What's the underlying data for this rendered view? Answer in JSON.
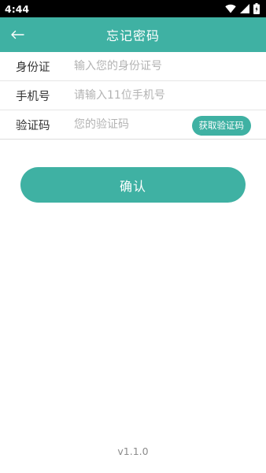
{
  "status_bar": {
    "time": "4:44",
    "icons": [
      "wifi-icon",
      "cell-signal-icon",
      "battery-charging-icon"
    ]
  },
  "app_bar": {
    "title": "忘记密码",
    "back_icon": "arrow-left-icon"
  },
  "form": {
    "id_card": {
      "label": "身份证",
      "placeholder": "输入您的身份证号",
      "value": ""
    },
    "phone": {
      "label": "手机号",
      "placeholder": "请输入11位手机号",
      "value": ""
    },
    "code": {
      "label": "验证码",
      "placeholder": "您的验证码",
      "value": "",
      "button_label": "获取验证码"
    }
  },
  "confirm_label": "确认",
  "version": "v1.1.0",
  "colors": {
    "accent": "#3fb1a3",
    "status_bar": "#000000",
    "placeholder": "#b3b3b3"
  }
}
